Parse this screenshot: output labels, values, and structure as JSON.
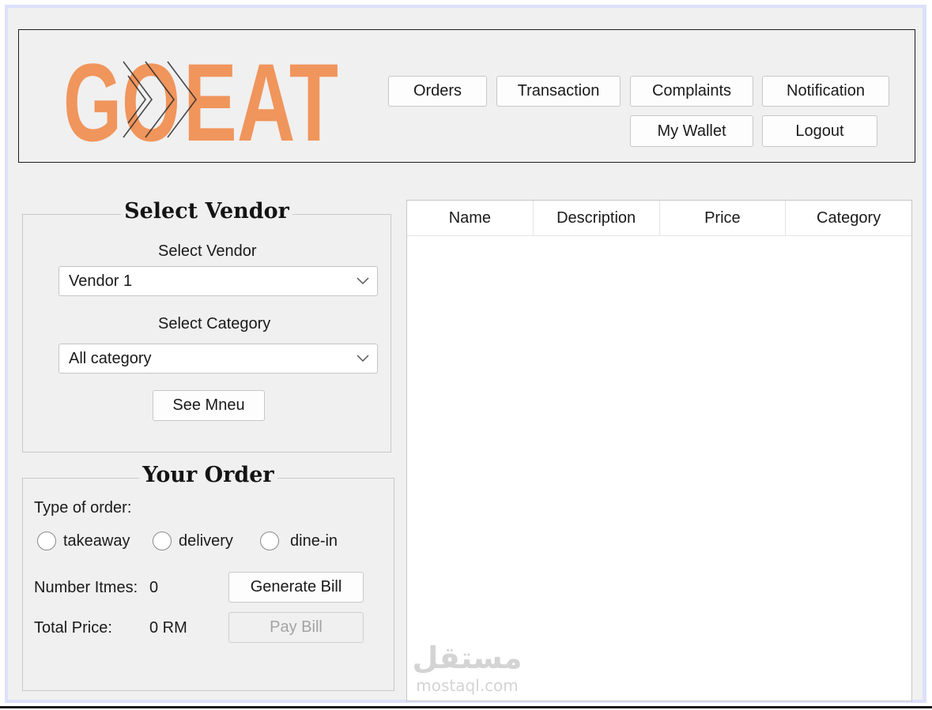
{
  "header": {
    "logo": {
      "part1": "GO",
      "part2": "EAT",
      "color": "#f0955c"
    },
    "nav": {
      "orders": "Orders",
      "transaction": "Transaction",
      "complaints": "Complaints",
      "notification": "Notification",
      "wallet": "My Wallet",
      "logout": "Logout"
    }
  },
  "vendor_panel": {
    "title": "Select Vendor",
    "vendor_label": "Select Vendor",
    "vendor_value": "Vendor 1",
    "category_label": "Select Category",
    "category_value": "All category",
    "see_menu": "See Mneu"
  },
  "order_panel": {
    "title": "Your Order",
    "type_label": "Type of order:",
    "options": [
      "takeaway",
      "delivery",
      "dine-in"
    ],
    "items_label": "Number Itmes:",
    "items_value": "0",
    "total_label": "Total Price:",
    "total_value": "0 RM",
    "generate_bill": "Generate Bill",
    "pay_bill": "Pay Bill"
  },
  "menu_table": {
    "columns": [
      "Name",
      "Description",
      "Price",
      "Category"
    ]
  },
  "watermark": {
    "arabic": "مستقل",
    "latin": "mostaql.com"
  },
  "colors": {
    "accent": "#f0955c",
    "window_bg": "#f0f0f0",
    "frame": "#dde0fa"
  }
}
